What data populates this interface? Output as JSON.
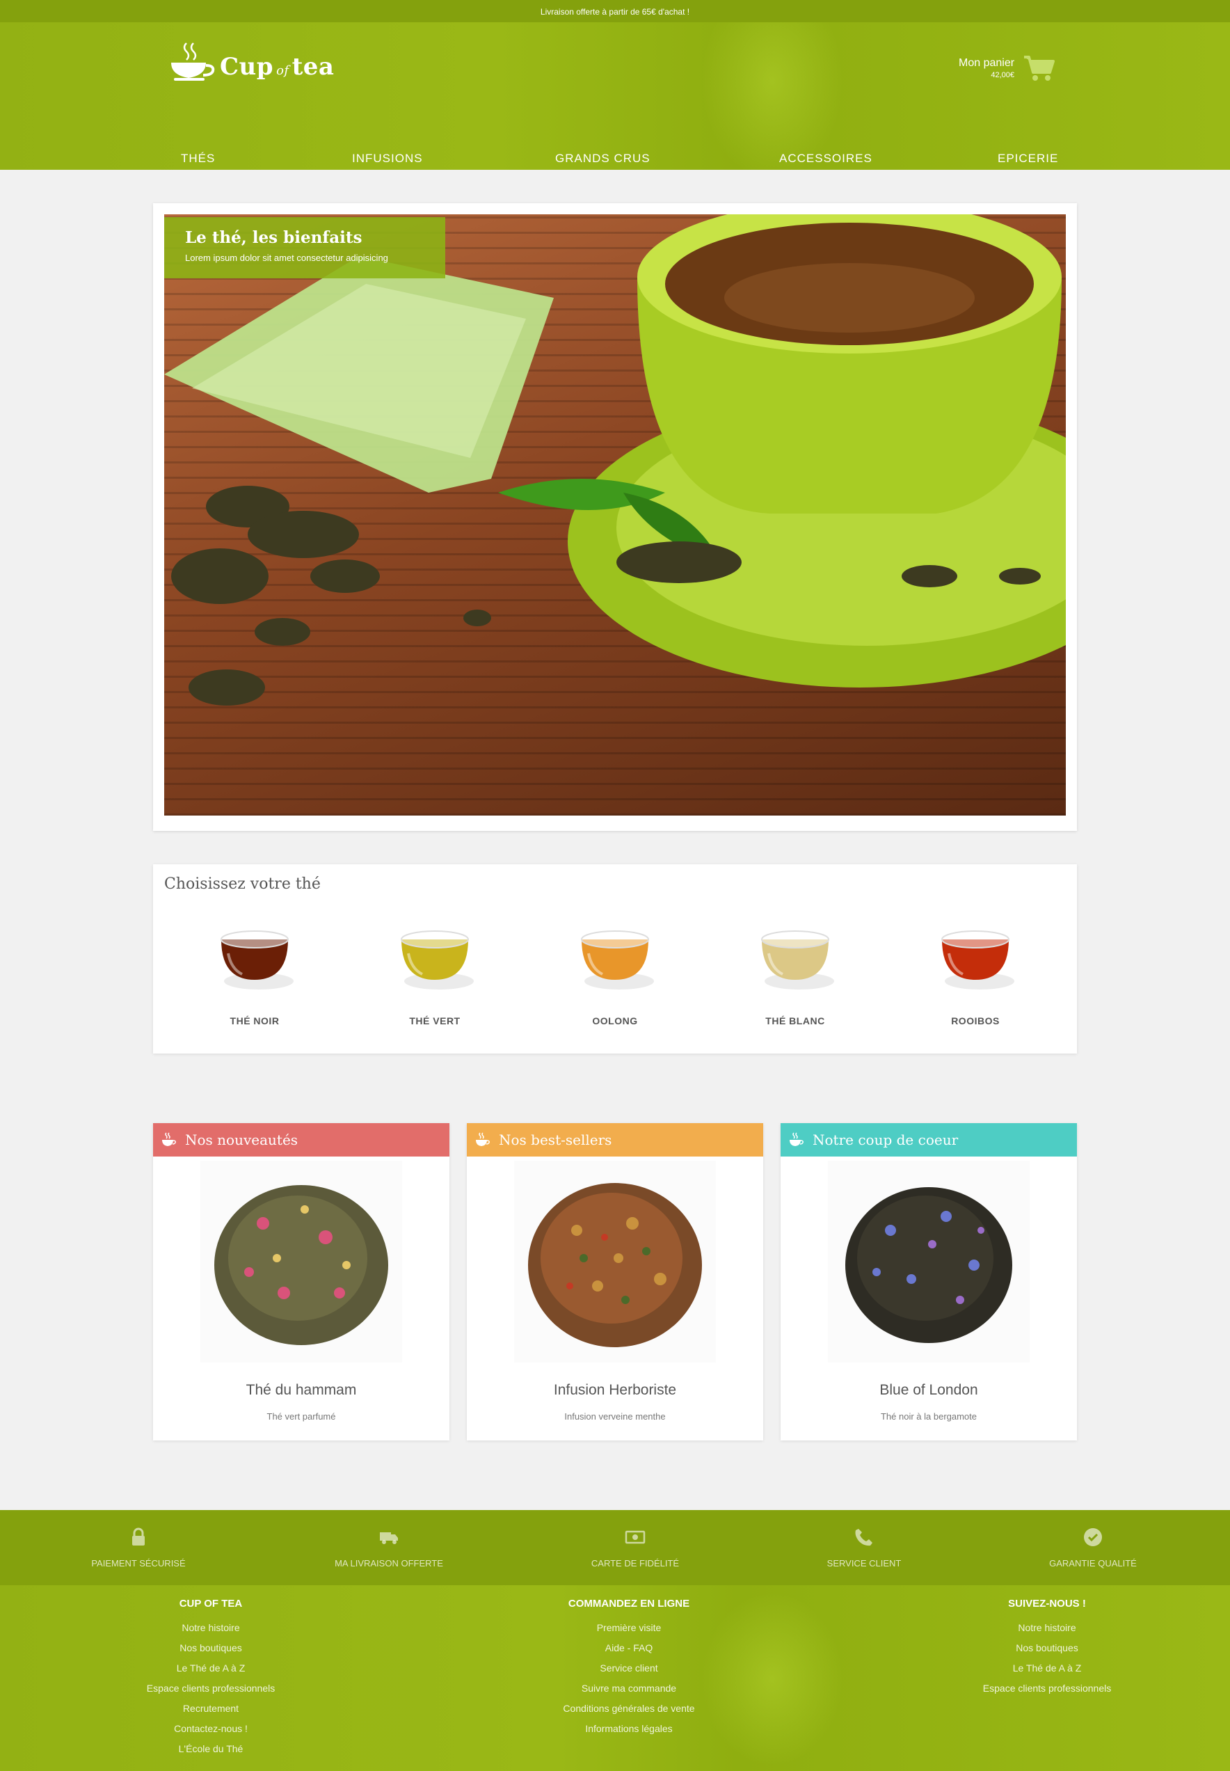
{
  "topbar": {
    "text": "Livraison offerte à partir de 65€ d'achat !"
  },
  "logo": {
    "part1": "Cup",
    "part2": "of",
    "part3": "tea"
  },
  "cart": {
    "label": "Mon panier",
    "total": "42,00€"
  },
  "nav": [
    "THÉS",
    "INFUSIONS",
    "GRANDS CRUS",
    "ACCESSOIRES",
    "EPICERIE"
  ],
  "hero": {
    "title": "Le thé, les bienfaits",
    "subtitle": "Lorem ipsum dolor sit amet consectetur adipisicing"
  },
  "choose": {
    "title": "Choisissez votre thé",
    "types": [
      {
        "label": "THÉ NOIR",
        "color": "#6b1f06"
      },
      {
        "label": "THÉ VERT",
        "color": "#c9b41c"
      },
      {
        "label": "OOLONG",
        "color": "#e8962a"
      },
      {
        "label": "THÉ BLANC",
        "color": "#dcc886"
      },
      {
        "label": "ROOIBOS",
        "color": "#c42d0a"
      }
    ]
  },
  "products": [
    {
      "heading": "Nos nouveautés",
      "color": "#e26d6a",
      "name": "Thé du hammam",
      "desc": "Thé vert parfumé"
    },
    {
      "heading": "Nos best-sellers",
      "color": "#f2ad4d",
      "name": "Infusion Herboriste",
      "desc": "Infusion verveine menthe"
    },
    {
      "heading": "Notre coup de coeur",
      "color": "#4ecdc4",
      "name": "Blue of London",
      "desc": "Thé noir à la bergamote"
    }
  ],
  "assurances": [
    {
      "label": "PAIEMENT SÉCURISÉ",
      "icon": "lock-icon"
    },
    {
      "label": "MA LIVRAISON OFFERTE",
      "icon": "truck-icon"
    },
    {
      "label": "CARTE DE FIDÉLITÉ",
      "icon": "money-icon"
    },
    {
      "label": "SERVICE CLIENT",
      "icon": "phone-icon"
    },
    {
      "label": "GARANTIE QUALITÉ",
      "icon": "check-circle-icon"
    }
  ],
  "footer": {
    "col1": {
      "heading": "CUP OF TEA",
      "links": [
        "Notre histoire",
        "Nos boutiques",
        "Le Thé de A à Z",
        "Espace clients professionnels",
        "Recrutement",
        "Contactez-nous !",
        "L'École du Thé"
      ]
    },
    "col2": {
      "heading": "COMMANDEZ EN LIGNE",
      "links": [
        "Première visite",
        "Aide - FAQ",
        "Service client",
        "Suivre ma commande",
        "Conditions générales de vente",
        "Informations légales"
      ]
    },
    "col3": {
      "heading": "SUIVEZ-NOUS !",
      "links": [
        "Notre histoire",
        "Nos boutiques",
        "Le Thé de A à Z",
        "Espace clients professionnels"
      ]
    }
  }
}
